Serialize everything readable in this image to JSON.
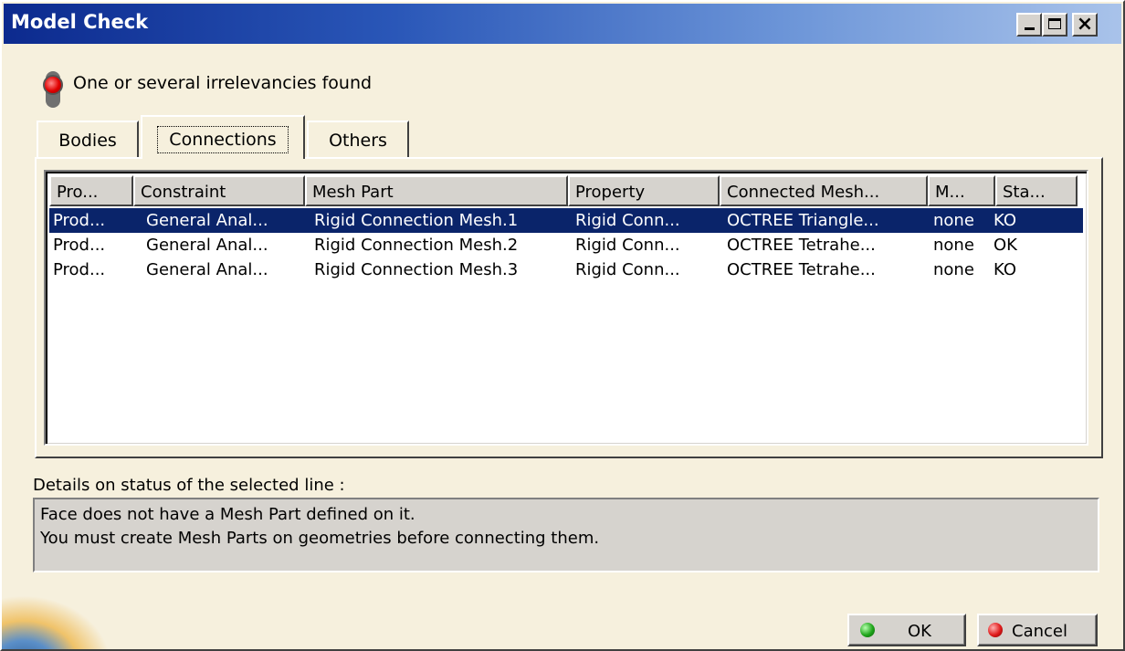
{
  "window": {
    "title": "Model Check"
  },
  "status": {
    "message": "One or several irrelevancies found",
    "indicator_color": "#e00000"
  },
  "tabs": [
    {
      "label": "Bodies"
    },
    {
      "label": "Connections",
      "active": true
    },
    {
      "label": "Others"
    }
  ],
  "table": {
    "columns": [
      "Pro...",
      "Constraint",
      "Mesh Part",
      "Property",
      "Connected Mesh...",
      "M...",
      "Sta..."
    ],
    "rows": [
      [
        "Prod...",
        "General Anal...",
        "Rigid Connection Mesh.1",
        "Rigid Conn...",
        "OCTREE Triangle...",
        "none",
        "KO"
      ],
      [
        "Prod...",
        "General Anal...",
        "Rigid Connection Mesh.2",
        "Rigid Conn...",
        "OCTREE Tetrahe...",
        "none",
        "OK"
      ],
      [
        "Prod...",
        "General Anal...",
        "Rigid Connection Mesh.3",
        "Rigid Conn...",
        "OCTREE Tetrahe...",
        "none",
        "KO"
      ]
    ],
    "selected_row": 0,
    "selection_color": "#0a246a"
  },
  "details": {
    "label": "Details on status of the selected line :",
    "line1": "Face does not have a Mesh Part defined on it.",
    "line2": "You must create Mesh Parts on geometries before connecting them."
  },
  "buttons": {
    "ok": "OK",
    "cancel": "Cancel"
  },
  "icons": {
    "status": "traffic-light-icon",
    "ok": "green-dot-icon",
    "cancel": "red-dot-icon"
  }
}
